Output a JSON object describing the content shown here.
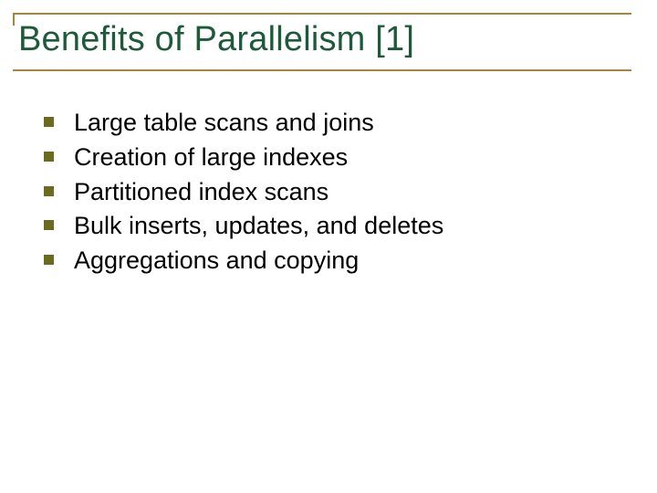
{
  "title": "Benefits of Parallelism [1]",
  "bullets": [
    "Large table scans and joins",
    "Creation of large indexes",
    "Partitioned index scans",
    "Bulk inserts, updates, and deletes",
    "Aggregations and copying"
  ],
  "colors": {
    "title": "#1d5a3a",
    "rule": "#a08a3a",
    "bullet": "#6b6b1e",
    "body": "#000000"
  }
}
